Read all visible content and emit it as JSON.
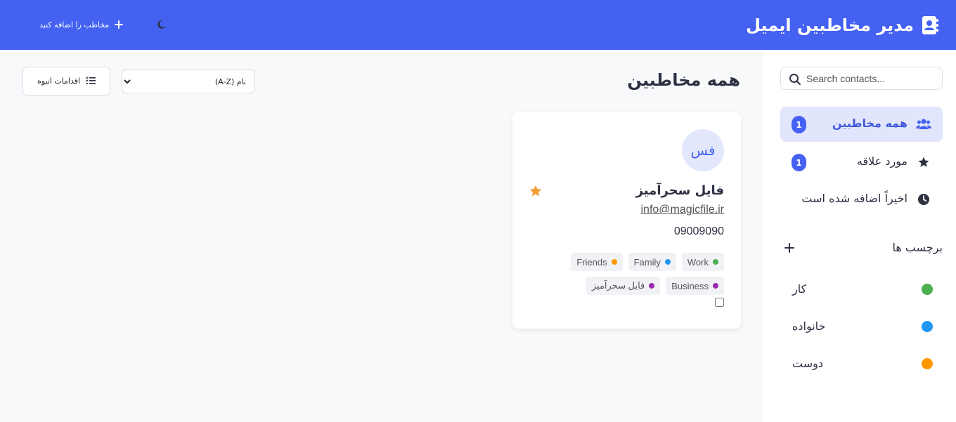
{
  "header": {
    "title": "مدیر مخاطبین ایمیل",
    "add_contact_label": "مخاطب را اضافه کنید"
  },
  "sidebar": {
    "search_placeholder": "Search contacts...",
    "nav": [
      {
        "label": "همه مخاطبین",
        "count": "1",
        "icon": "users-icon"
      },
      {
        "label": "مورد علاقه",
        "count": "1",
        "icon": "star-icon"
      },
      {
        "label": "اخیراً اضافه شده است",
        "icon": "clock-icon"
      }
    ],
    "tags_title": "برچسب ها",
    "tags": [
      {
        "label": "کار",
        "color": "#4caf50"
      },
      {
        "label": "خانواده",
        "color": "#2196f3"
      },
      {
        "label": "دوست",
        "color": "#ff9800"
      }
    ]
  },
  "main": {
    "title": "همه مخاطبین",
    "sort_selected": "نام (A-Z)",
    "bulk_actions_label": "اقدامات انبوه"
  },
  "contact": {
    "initials": "فس",
    "name": "فایل سحرآمیز",
    "email": "info@magicfile.ir",
    "phone": "09009090",
    "favorite": true,
    "tags": [
      {
        "label": "Work",
        "color": "#4caf50"
      },
      {
        "label": "Family",
        "color": "#2196f3"
      },
      {
        "label": "Friends",
        "color": "#ff9800"
      },
      {
        "label": "Business",
        "color": "#9c27b0"
      },
      {
        "label": "فایل سحرآمیز",
        "color": "#9c27b0"
      }
    ]
  },
  "colors": {
    "primary": "#4461f2",
    "star": "#f39c32"
  }
}
